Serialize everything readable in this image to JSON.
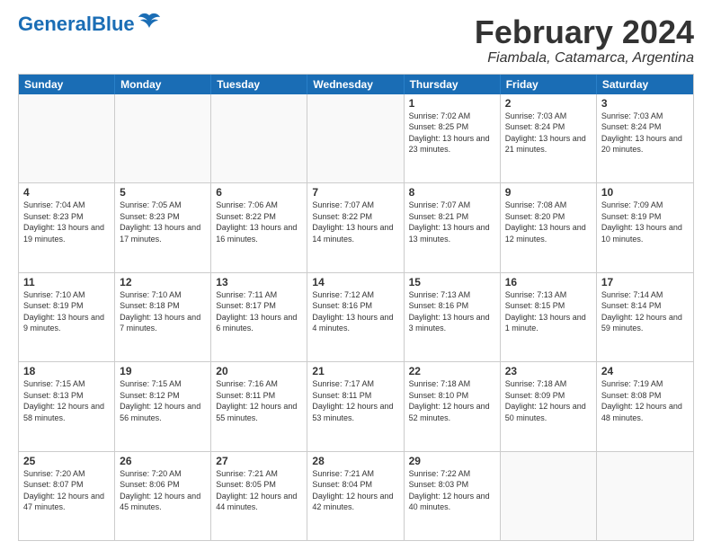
{
  "logo": {
    "part1": "General",
    "part2": "Blue"
  },
  "title": "February 2024",
  "subtitle": "Fiambala, Catamarca, Argentina",
  "days": [
    "Sunday",
    "Monday",
    "Tuesday",
    "Wednesday",
    "Thursday",
    "Friday",
    "Saturday"
  ],
  "rows": [
    [
      {
        "day": "",
        "empty": true
      },
      {
        "day": "",
        "empty": true
      },
      {
        "day": "",
        "empty": true
      },
      {
        "day": "",
        "empty": true
      },
      {
        "day": "1",
        "sunrise": "7:02 AM",
        "sunset": "8:25 PM",
        "daylight": "13 hours and 23 minutes."
      },
      {
        "day": "2",
        "sunrise": "7:03 AM",
        "sunset": "8:24 PM",
        "daylight": "13 hours and 21 minutes."
      },
      {
        "day": "3",
        "sunrise": "7:03 AM",
        "sunset": "8:24 PM",
        "daylight": "13 hours and 20 minutes."
      }
    ],
    [
      {
        "day": "4",
        "sunrise": "7:04 AM",
        "sunset": "8:23 PM",
        "daylight": "13 hours and 19 minutes."
      },
      {
        "day": "5",
        "sunrise": "7:05 AM",
        "sunset": "8:23 PM",
        "daylight": "13 hours and 17 minutes."
      },
      {
        "day": "6",
        "sunrise": "7:06 AM",
        "sunset": "8:22 PM",
        "daylight": "13 hours and 16 minutes."
      },
      {
        "day": "7",
        "sunrise": "7:07 AM",
        "sunset": "8:22 PM",
        "daylight": "13 hours and 14 minutes."
      },
      {
        "day": "8",
        "sunrise": "7:07 AM",
        "sunset": "8:21 PM",
        "daylight": "13 hours and 13 minutes."
      },
      {
        "day": "9",
        "sunrise": "7:08 AM",
        "sunset": "8:20 PM",
        "daylight": "13 hours and 12 minutes."
      },
      {
        "day": "10",
        "sunrise": "7:09 AM",
        "sunset": "8:19 PM",
        "daylight": "13 hours and 10 minutes."
      }
    ],
    [
      {
        "day": "11",
        "sunrise": "7:10 AM",
        "sunset": "8:19 PM",
        "daylight": "13 hours and 9 minutes."
      },
      {
        "day": "12",
        "sunrise": "7:10 AM",
        "sunset": "8:18 PM",
        "daylight": "13 hours and 7 minutes."
      },
      {
        "day": "13",
        "sunrise": "7:11 AM",
        "sunset": "8:17 PM",
        "daylight": "13 hours and 6 minutes."
      },
      {
        "day": "14",
        "sunrise": "7:12 AM",
        "sunset": "8:16 PM",
        "daylight": "13 hours and 4 minutes."
      },
      {
        "day": "15",
        "sunrise": "7:13 AM",
        "sunset": "8:16 PM",
        "daylight": "13 hours and 3 minutes."
      },
      {
        "day": "16",
        "sunrise": "7:13 AM",
        "sunset": "8:15 PM",
        "daylight": "13 hours and 1 minute."
      },
      {
        "day": "17",
        "sunrise": "7:14 AM",
        "sunset": "8:14 PM",
        "daylight": "12 hours and 59 minutes."
      }
    ],
    [
      {
        "day": "18",
        "sunrise": "7:15 AM",
        "sunset": "8:13 PM",
        "daylight": "12 hours and 58 minutes."
      },
      {
        "day": "19",
        "sunrise": "7:15 AM",
        "sunset": "8:12 PM",
        "daylight": "12 hours and 56 minutes."
      },
      {
        "day": "20",
        "sunrise": "7:16 AM",
        "sunset": "8:11 PM",
        "daylight": "12 hours and 55 minutes."
      },
      {
        "day": "21",
        "sunrise": "7:17 AM",
        "sunset": "8:11 PM",
        "daylight": "12 hours and 53 minutes."
      },
      {
        "day": "22",
        "sunrise": "7:18 AM",
        "sunset": "8:10 PM",
        "daylight": "12 hours and 52 minutes."
      },
      {
        "day": "23",
        "sunrise": "7:18 AM",
        "sunset": "8:09 PM",
        "daylight": "12 hours and 50 minutes."
      },
      {
        "day": "24",
        "sunrise": "7:19 AM",
        "sunset": "8:08 PM",
        "daylight": "12 hours and 48 minutes."
      }
    ],
    [
      {
        "day": "25",
        "sunrise": "7:20 AM",
        "sunset": "8:07 PM",
        "daylight": "12 hours and 47 minutes."
      },
      {
        "day": "26",
        "sunrise": "7:20 AM",
        "sunset": "8:06 PM",
        "daylight": "12 hours and 45 minutes."
      },
      {
        "day": "27",
        "sunrise": "7:21 AM",
        "sunset": "8:05 PM",
        "daylight": "12 hours and 44 minutes."
      },
      {
        "day": "28",
        "sunrise": "7:21 AM",
        "sunset": "8:04 PM",
        "daylight": "12 hours and 42 minutes."
      },
      {
        "day": "29",
        "sunrise": "7:22 AM",
        "sunset": "8:03 PM",
        "daylight": "12 hours and 40 minutes."
      },
      {
        "day": "",
        "empty": true
      },
      {
        "day": "",
        "empty": true
      }
    ]
  ]
}
